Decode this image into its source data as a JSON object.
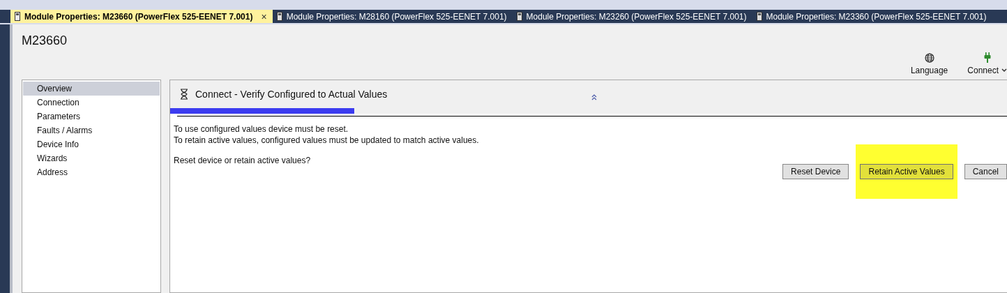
{
  "tabs": [
    {
      "label": "Module Properties:  M23660 (PowerFlex 525-EENET 7.001)",
      "selected": true,
      "close": "×"
    },
    {
      "label": "Module Properties:  M28160 (PowerFlex 525-EENET 7.001)",
      "selected": false
    },
    {
      "label": "Module Properties:  M23260 (PowerFlex 525-EENET 7.001)",
      "selected": false
    },
    {
      "label": "Module Properties:  M23360 (PowerFlex 525-EENET 7.001)",
      "selected": false
    }
  ],
  "module_name": "M23660",
  "toolbar": [
    {
      "kind": "language",
      "label": "Language"
    },
    {
      "kind": "connect",
      "label": "Connect",
      "dropdown": true
    }
  ],
  "sidebar": {
    "items": [
      {
        "label": "Overview",
        "selected": true
      },
      {
        "label": "Connection",
        "selected": false
      },
      {
        "label": "Parameters",
        "selected": false
      },
      {
        "label": "Faults / Alarms",
        "selected": false
      },
      {
        "label": "Device Info",
        "selected": false
      },
      {
        "label": "Wizards",
        "selected": false
      },
      {
        "label": "Address",
        "selected": false
      }
    ]
  },
  "panel": {
    "title": "Connect  -  Verify Configured to Actual Values",
    "progress": {
      "level": 0.22
    },
    "messages": [
      "To use configured values device must be reset.",
      "To retain active values, configured values must be updated to match active values."
    ],
    "question": "Reset device or retain active values?",
    "buttons": [
      {
        "label": "Reset Device",
        "highlighted": false
      },
      {
        "label": "Retain Active Values",
        "highlighted": true
      },
      {
        "label": "Cancel",
        "highlighted": false
      }
    ]
  }
}
